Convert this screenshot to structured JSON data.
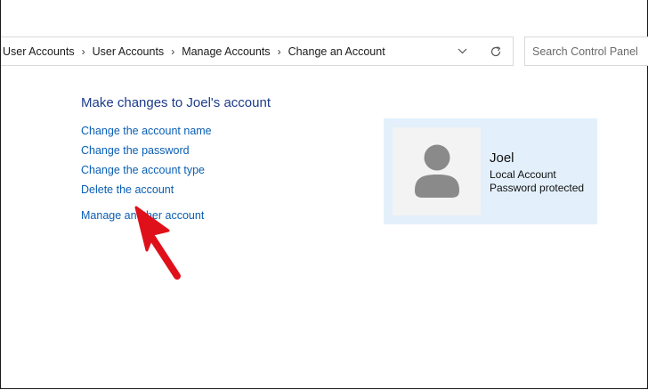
{
  "breadcrumb": {
    "items": [
      "User Accounts",
      "User Accounts",
      "Manage Accounts",
      "Change an Account"
    ]
  },
  "search": {
    "placeholder": "Search Control Panel"
  },
  "icons": {
    "dropdown": "chevron-down-icon",
    "refresh": "refresh-icon",
    "avatar": "user-silhouette-icon",
    "pointer": "red-arrow-annotation"
  },
  "main": {
    "title": "Make changes to Joel's account",
    "links": [
      "Change the account name",
      "Change the password",
      "Change the account type",
      "Delete the account",
      "Manage another account"
    ]
  },
  "account": {
    "name": "Joel",
    "type": "Local Account",
    "status": "Password protected"
  },
  "colors": {
    "link": "#0a5fb4",
    "title": "#1c3b8c",
    "card_bg": "#e3f0fb",
    "arrow": "#e0101a"
  }
}
